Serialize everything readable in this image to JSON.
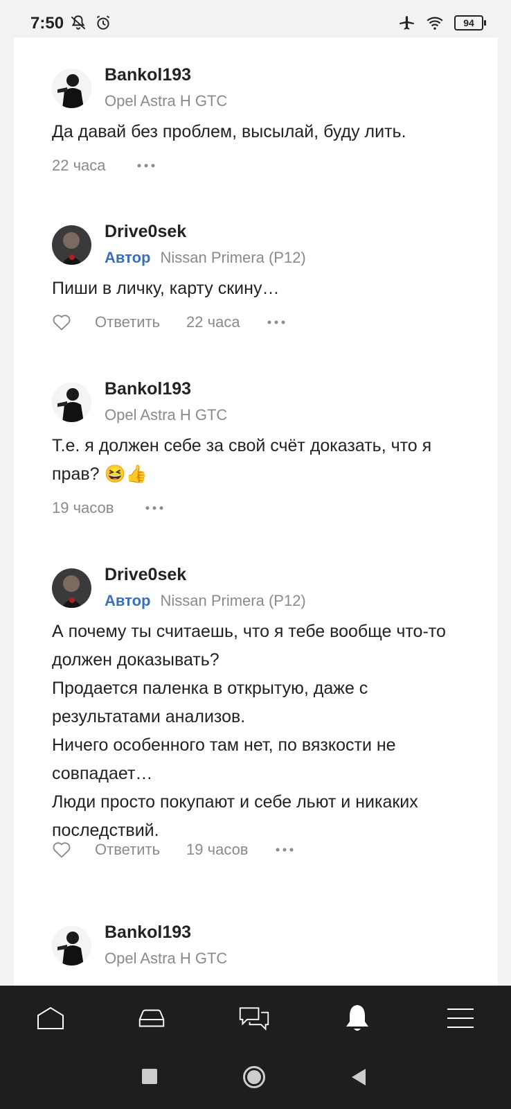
{
  "status_bar": {
    "time": "7:50",
    "battery": "94",
    "icons": [
      "notifications-muted-icon",
      "alarm-icon",
      "airplane-icon",
      "wifi-icon",
      "battery-icon"
    ]
  },
  "comments": [
    {
      "author": "Bankol193",
      "author_badge": "",
      "car": "Opel Astra H GTC",
      "text": [
        "Да давай без проблем, высылай, буду лить."
      ],
      "time": "22 часа",
      "reply_label": ""
    },
    {
      "author": "Drive0sek",
      "author_badge": "Автор",
      "car": "Nissan Primera (P12)",
      "text": [
        "Пиши в личку, карту скину…"
      ],
      "time": "22 часа",
      "reply_label": "Ответить"
    },
    {
      "author": "Bankol193",
      "author_badge": "",
      "car": "Opel Astra H GTC",
      "text": [
        "Т.е. я должен себе за свой счёт доказать, что я прав? 😆👍"
      ],
      "time": "19 часов",
      "reply_label": ""
    },
    {
      "author": "Drive0sek",
      "author_badge": "Автор",
      "car": "Nissan Primera (P12)",
      "text": [
        "А почему ты считаешь, что я тебе вообще что-то должен доказывать?",
        "Продается паленка в открытую, даже с результатами анализов.",
        "Ничего особенного там нет, по вязкости не совпадает…",
        "Люди просто покупают и себе льют и никаких последствий."
      ],
      "time": "19 часов",
      "reply_label": "Ответить"
    },
    {
      "author": "Bankol193",
      "author_badge": "",
      "car": "Opel Astra H GTC",
      "text": [],
      "time": "",
      "reply_label": ""
    }
  ],
  "bottom_nav": {
    "items": [
      "home-icon",
      "garage-car-icon",
      "messages-icon",
      "notifications-bell-icon",
      "menu-icon"
    ],
    "active": "notifications-bell-icon"
  },
  "system_nav": [
    "recents-button",
    "home-button",
    "back-button"
  ]
}
